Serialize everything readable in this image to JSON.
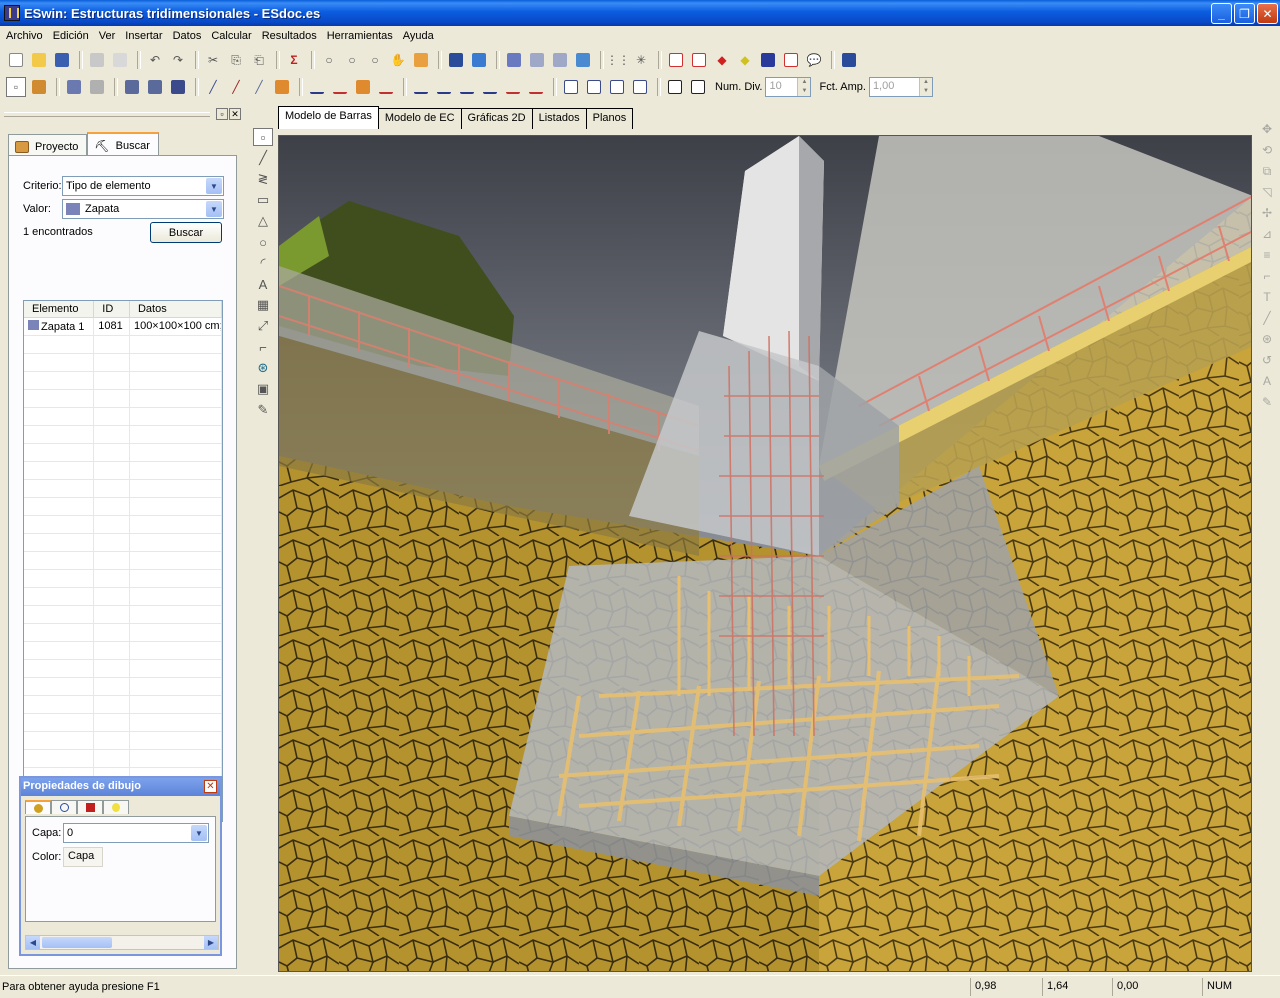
{
  "window": {
    "title": "ESwin: Estructuras tridimensionales - ESdoc.es"
  },
  "menu": [
    "Archivo",
    "Edición",
    "Ver",
    "Insertar",
    "Datos",
    "Calcular",
    "Resultados",
    "Herramientas",
    "Ayuda"
  ],
  "toolbar2": {
    "num_div_label": "Num. Div.",
    "num_div_value": "10",
    "fct_amp_label": "Fct. Amp.",
    "fct_amp_value": "1,00"
  },
  "left_panel": {
    "tabs": [
      "Proyecto",
      "Buscar"
    ],
    "active_tab": "Buscar",
    "criterio_label": "Criterio:",
    "criterio_value": "Tipo de elemento",
    "valor_label": "Valor:",
    "valor_value": "Zapata",
    "found_text": "1 encontrados",
    "search_button": "Buscar",
    "grid": {
      "headers": [
        "Elemento",
        "ID",
        "Datos"
      ],
      "rows": [
        {
          "elemento": "Zapata 1",
          "id": "1081",
          "datos": "100×100×100 cm;"
        }
      ]
    }
  },
  "properties": {
    "title": "Propiedades de dibujo",
    "capa_label": "Capa:",
    "capa_value": "0",
    "color_label": "Color:",
    "color_value": "Capa"
  },
  "doc_tabs": [
    "Modelo de Barras",
    "Modelo de EC",
    "Gráficas 2D",
    "Listados",
    "Planos"
  ],
  "active_doc_tab": "Modelo de Barras",
  "statusbar": {
    "message": "Para obtener ayuda presione F1",
    "x": "0,98",
    "y": "1,64",
    "z": "0,00",
    "num": "NUM"
  },
  "colors": {
    "titlebar": "#0b5de0",
    "ground": "#b4932f",
    "concrete": "#b9bcc0",
    "rebar": "#e8b070",
    "beam_edge": "#e0c86a"
  },
  "icons": {
    "project_tab": "folder-box-icon",
    "search_tab": "binoculars-icon",
    "zapata": "footing-icon"
  }
}
